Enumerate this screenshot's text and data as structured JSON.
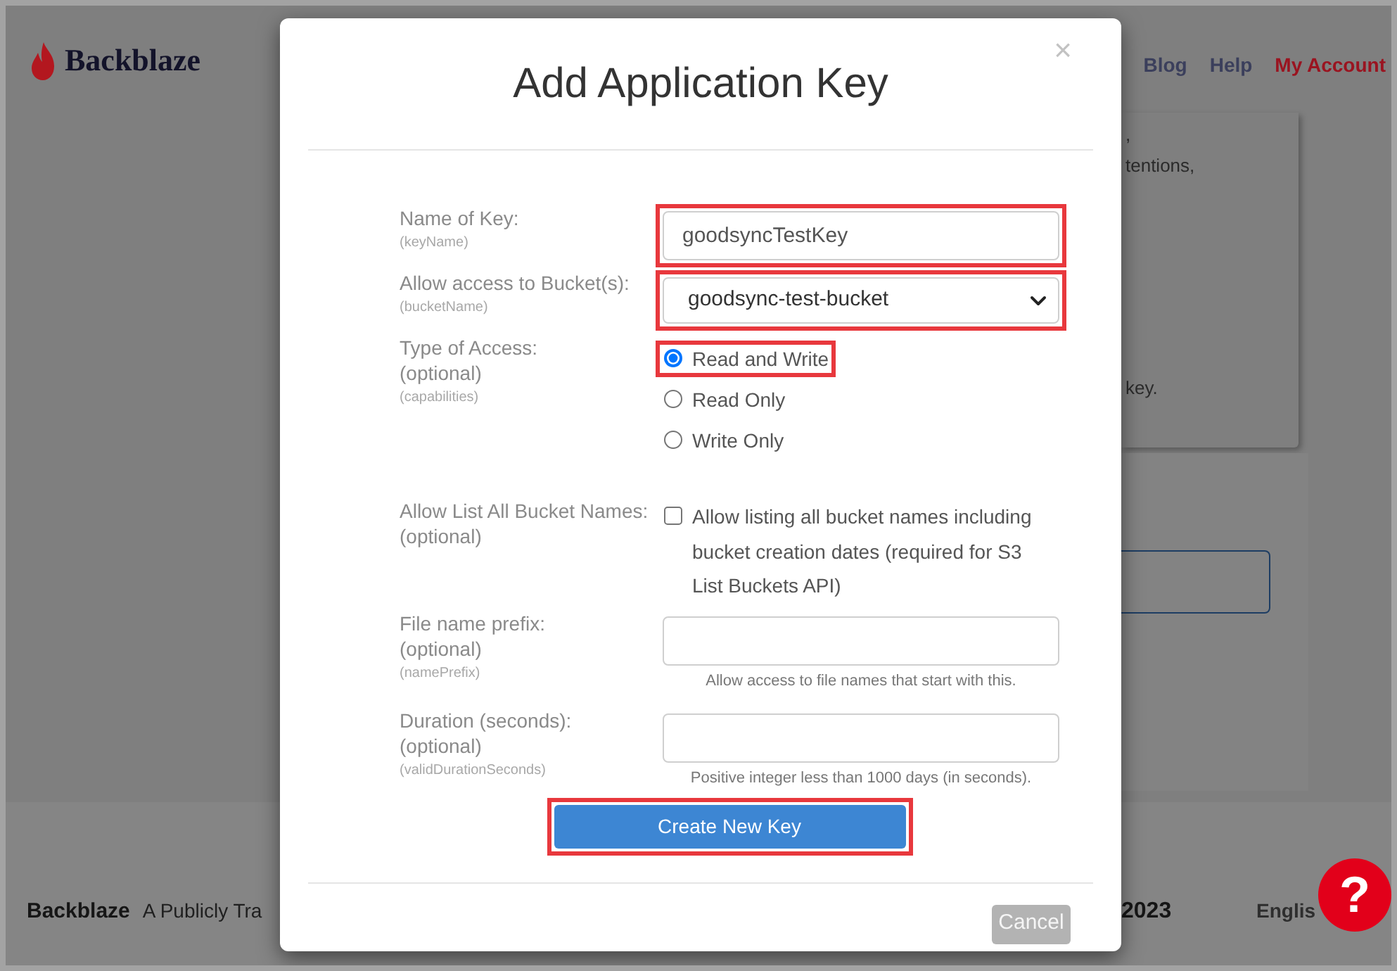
{
  "page": {
    "logo": "Backblaze",
    "nav": [
      {
        "label": "Blog",
        "color": "#3b3f5c"
      },
      {
        "label": "Help",
        "color": "#3b3f5c"
      },
      {
        "label": "My Account",
        "color": "#9a1420"
      }
    ],
    "card": {
      "top_lines": [
        ",",
        "tentions,"
      ],
      "bottom_line": "key."
    },
    "footer": {
      "brand": "Backblaze",
      "tagline": "A Publicly Tra",
      "year": "2023",
      "language": "Englis"
    },
    "help_button": "?"
  },
  "dialog": {
    "title": "Add Application Key",
    "close": "×",
    "fields": [
      {
        "kind": "text",
        "label": "Name of Key:",
        "hint": "(keyName)",
        "value": "goodsyncTestKey",
        "highlighted": true
      },
      {
        "kind": "select",
        "label": "Allow access to Bucket(s):",
        "hint": "(bucketName)",
        "value": "goodsync-test-bucket",
        "highlighted": true
      },
      {
        "kind": "radio",
        "label": "Type of Access:",
        "optional": "(optional)",
        "hint": "(capabilities)",
        "options": [
          {
            "label": "Read and Write",
            "selected": true,
            "highlighted": true
          },
          {
            "label": "Read Only",
            "selected": false,
            "highlighted": false
          },
          {
            "label": "Write Only",
            "selected": false,
            "highlighted": false
          }
        ]
      },
      {
        "kind": "checkbox",
        "label": "Allow List All Bucket Names:",
        "optional": "(optional)",
        "text": "Allow listing all bucket names including bucket creation dates (required for S3 List Buckets API)",
        "checked": false
      },
      {
        "kind": "text",
        "label": "File name prefix:",
        "optional": "(optional)",
        "hint": "(namePrefix)",
        "help": "Allow access to file names that start with this.",
        "highlighted": false
      },
      {
        "kind": "text",
        "label": "Duration (seconds):",
        "optional": "(optional)",
        "hint": "(validDurationSeconds)",
        "help": "Positive integer less than 1000 days (in seconds).",
        "highlighted": false
      }
    ],
    "submit": {
      "label": "Create New Key",
      "highlighted": true
    },
    "cancel": "Cancel"
  }
}
